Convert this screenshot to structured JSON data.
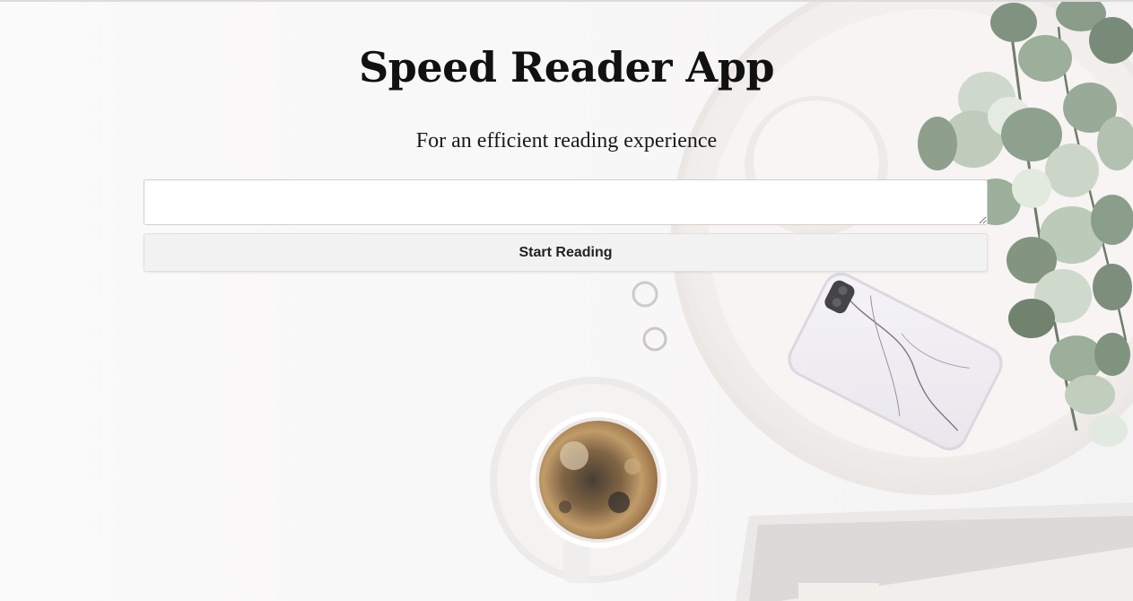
{
  "header": {
    "title": "Speed Reader App",
    "subtitle": "For an efficient reading experience"
  },
  "form": {
    "text_input_value": "",
    "text_input_placeholder": "",
    "start_button_label": "Start Reading"
  },
  "background": {
    "description_icon": "desk-flatlay-photo",
    "accent_colors": {
      "plate": "#f3f0ee",
      "leaves": "#7f9580",
      "coffee": "#6a4a2a"
    }
  }
}
